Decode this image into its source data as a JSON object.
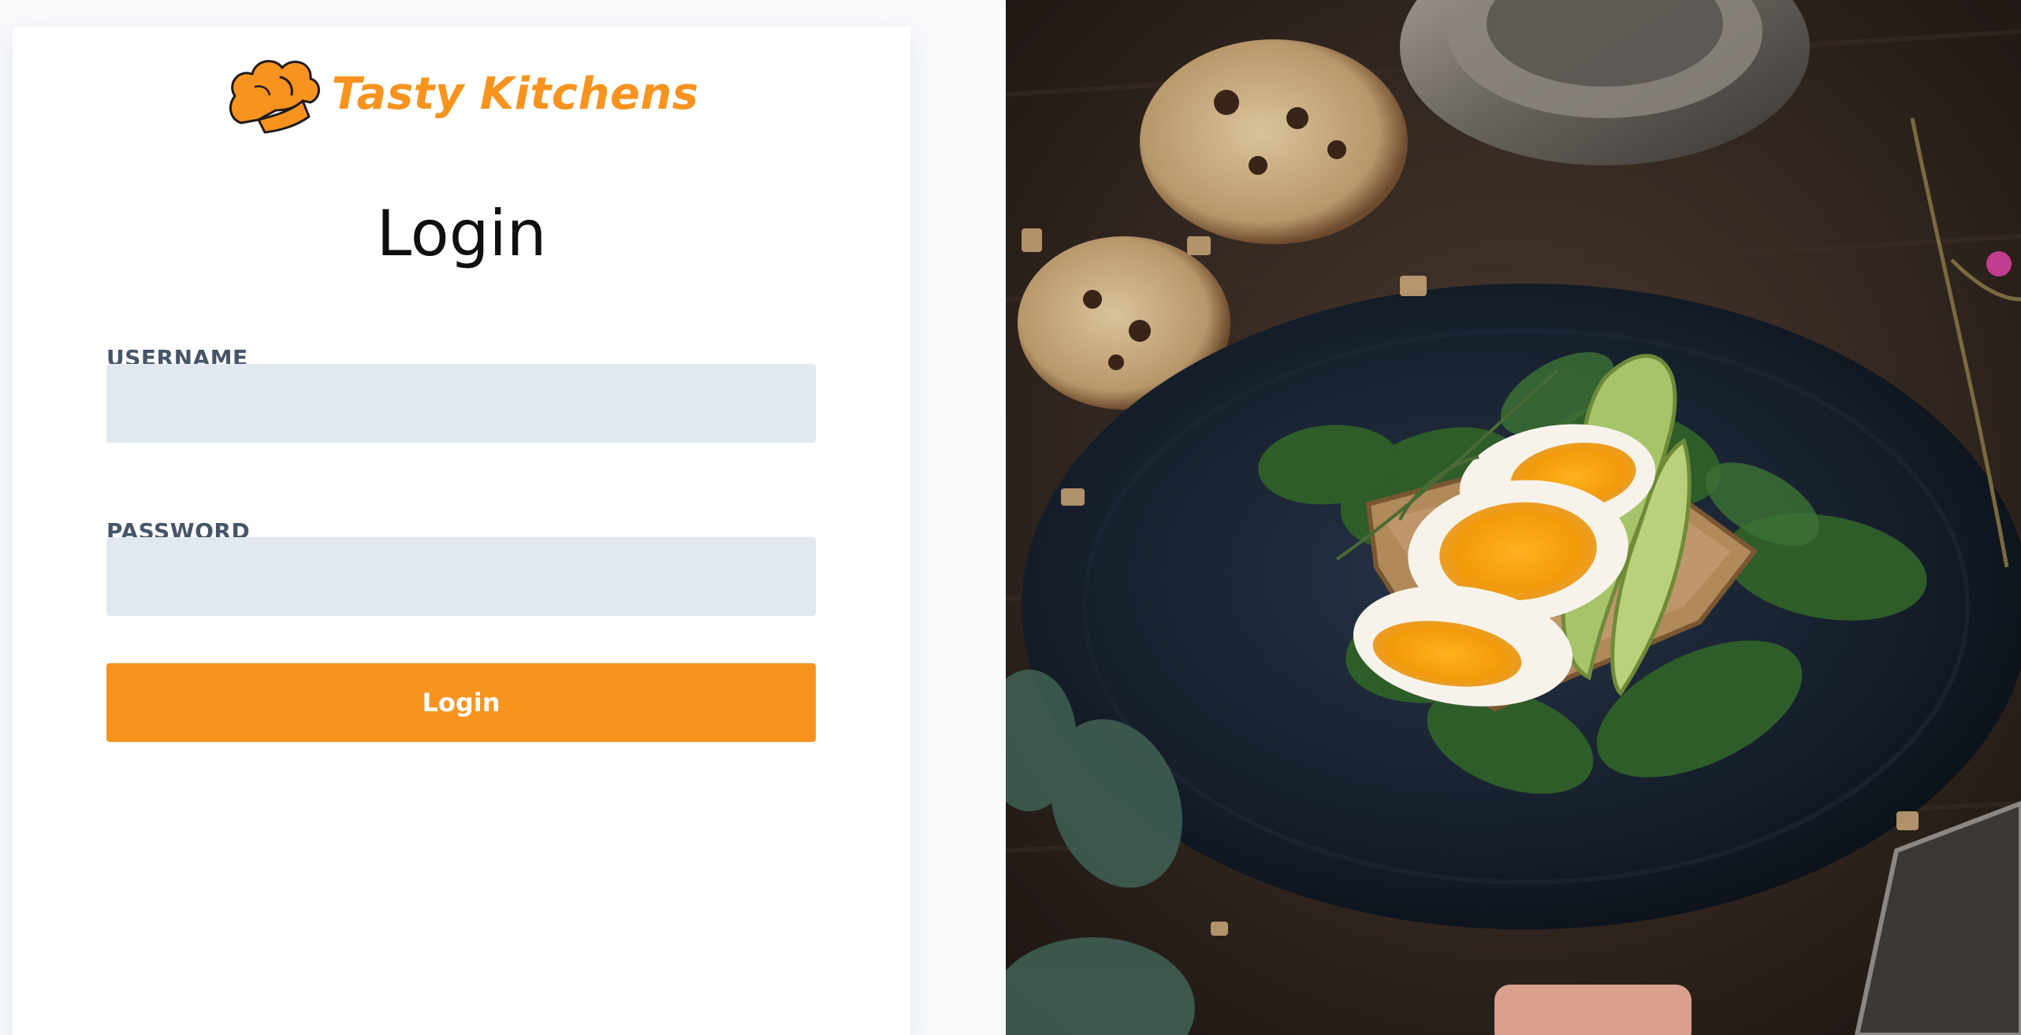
{
  "brand": {
    "name": "Tasty Kitchens",
    "icon": "chef-hat-icon",
    "color": "#f7931e"
  },
  "login": {
    "heading": "Login",
    "username_label": "USERNAME",
    "username_value": "",
    "password_label": "PASSWORD",
    "password_value": "",
    "button_label": "Login",
    "button_color": "#f7931e",
    "input_background": "#e2e8f0"
  },
  "hero": {
    "image": "food-photo",
    "subject": "egg-avocado-toast"
  }
}
